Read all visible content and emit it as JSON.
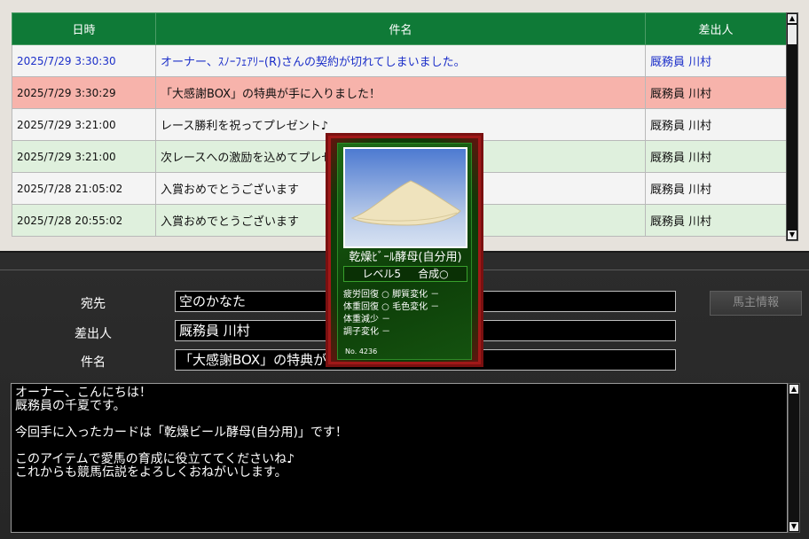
{
  "mail_list": {
    "headers": {
      "date": "日時",
      "subject": "件名",
      "sender": "差出人"
    },
    "rows": [
      {
        "date": "2025/7/29 3:30:30",
        "subject": "オーナー、ｽﾉｰﾌｪｱﾘｰ(R)さんの契約が切れてしまいました。",
        "sender": "厩務員 川村"
      },
      {
        "date": "2025/7/29 3:30:29",
        "subject": "「大感謝BOX」の特典が手に入りました！",
        "sender": "厩務員 川村"
      },
      {
        "date": "2025/7/29 3:21:00",
        "subject": "レース勝利を祝ってプレゼント♪",
        "sender": "厩務員 川村"
      },
      {
        "date": "2025/7/29 3:21:00",
        "subject": "次レースへの激励を込めてプレゼント",
        "sender": "厩務員 川村"
      },
      {
        "date": "2025/7/28 21:05:02",
        "subject": "入賞おめでとうございます",
        "sender": "厩務員 川村"
      },
      {
        "date": "2025/7/28 20:55:02",
        "subject": "入賞おめでとうございます",
        "sender": "厩務員 川村"
      }
    ]
  },
  "detail": {
    "to_label": "宛先",
    "to_value": "空のかなた",
    "from_label": "差出人",
    "from_value": "厩務員 川村",
    "subject_label": "件名",
    "subject_value": "「大感謝BOX」の特典が手に入りました！",
    "owner_info_button": "馬主情報",
    "body_lines": [
      "オーナー、こんにちは！",
      "厩務員の千夏です。",
      "",
      "今回手に入ったカードは「乾燥ビール酵母(自分用)」です！",
      "",
      "このアイテムで愛馬の育成に役立ててくださいね♪",
      "これからも競馬伝説をよろしくおねがいします。"
    ]
  },
  "card": {
    "name": "乾燥ﾋﾞｰﾙ酵母(自分用)",
    "level": "レベル5",
    "synth": "合成○",
    "effects": [
      "疲労回復 ○ 脚質変化 －",
      "体重回復 ○ 毛色変化 －",
      "体重減少 －",
      "調子変化 －"
    ],
    "number": "No. 4236"
  },
  "colors": {
    "header_green": "#0f7a37",
    "row_pink": "#f7b3ab",
    "row_green": "#dff0dd",
    "unread_blue": "#1c2fc9"
  }
}
